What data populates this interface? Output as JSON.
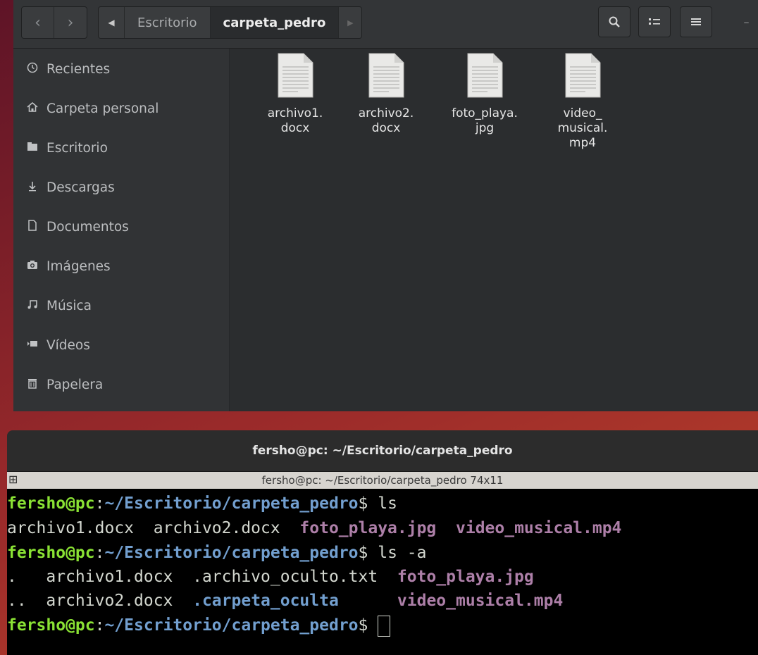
{
  "file_manager": {
    "breadcrumb": [
      {
        "label": "Escritorio",
        "active": false
      },
      {
        "label": "carpeta_pedro",
        "active": true
      }
    ],
    "sidebar": {
      "items": [
        {
          "label": "Recientes",
          "icon": "clock-icon"
        },
        {
          "label": "Carpeta personal",
          "icon": "home-icon"
        },
        {
          "label": "Escritorio",
          "icon": "folder-icon"
        },
        {
          "label": "Descargas",
          "icon": "download-icon"
        },
        {
          "label": "Documentos",
          "icon": "document-icon"
        },
        {
          "label": "Imágenes",
          "icon": "camera-icon"
        },
        {
          "label": "Música",
          "icon": "music-icon"
        },
        {
          "label": "Vídeos",
          "icon": "video-icon"
        },
        {
          "label": "Papelera",
          "icon": "trash-icon"
        }
      ]
    },
    "files": [
      {
        "name": "archivo1.\ndocx"
      },
      {
        "name": "archivo2.\ndocx"
      },
      {
        "name": "foto_playa.\njpg"
      },
      {
        "name": "video_\nmusical.\nmp4"
      }
    ]
  },
  "terminal": {
    "title": "fersho@pc: ~/Escritorio/carpeta_pedro",
    "subtitle": "fersho@pc: ~/Escritorio/carpeta_pedro 74x11",
    "prompt_user": "fersho@pc",
    "prompt_sep": ":",
    "prompt_path": "~/Escritorio/carpeta_pedro",
    "prompt_symbol": "$ ",
    "lines": {
      "cmd1": "ls",
      "out1_a": "archivo1.docx  archivo2.docx  ",
      "out1_b": "foto_playa.jpg",
      "out1_c": "  ",
      "out1_d": "video_musical.mp4",
      "cmd2": "ls -a",
      "out2_a": ".   archivo1.docx  .archivo_oculto.txt  ",
      "out2_b": "foto_playa.jpg",
      "out3_a": "..  archivo2.docx  ",
      "out3_b": ".carpeta_oculta",
      "out3_c": "      ",
      "out3_d": "video_musical.mp4"
    }
  },
  "colors": {
    "prompt_user": "#8ae234",
    "prompt_path": "#729fcf",
    "media_file": "#ad7fa8"
  }
}
